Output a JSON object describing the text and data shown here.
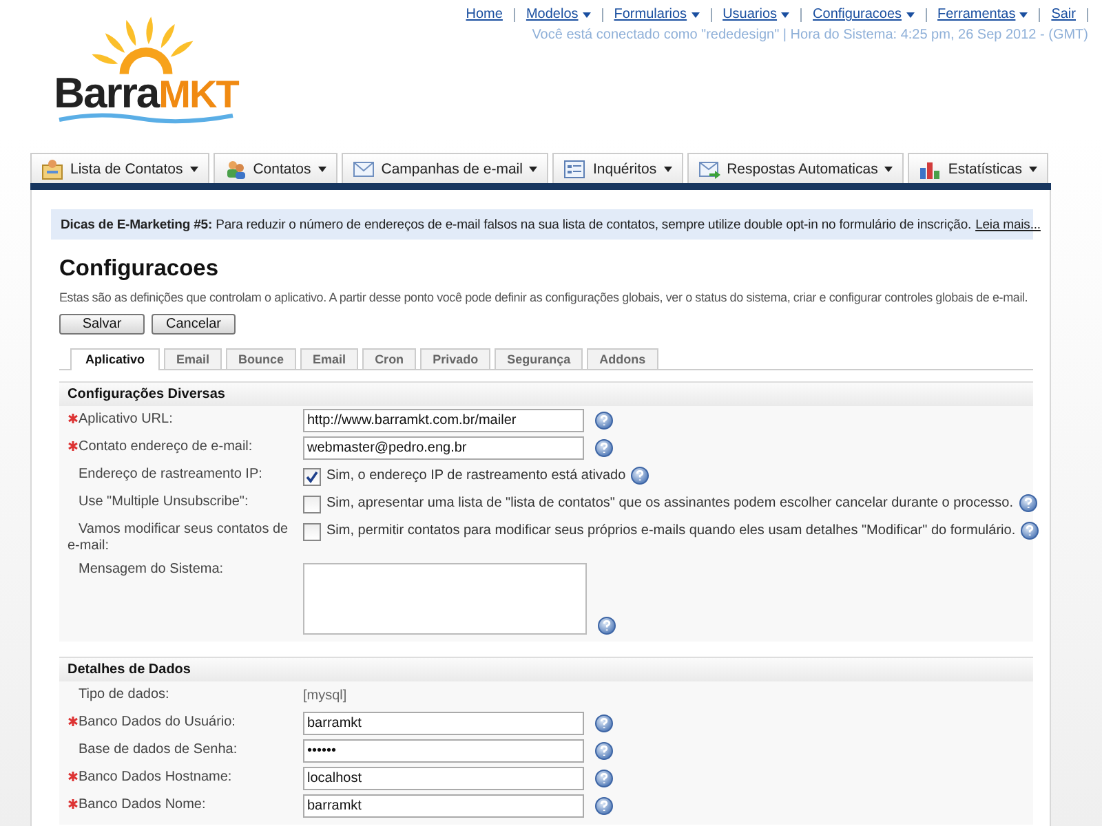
{
  "logo": {
    "part1": "Barra",
    "part2": "MKT"
  },
  "top_links": [
    {
      "label": "Home",
      "dropdown": false
    },
    {
      "label": "Modelos",
      "dropdown": true
    },
    {
      "label": "Formularios",
      "dropdown": true
    },
    {
      "label": "Usuarios",
      "dropdown": true
    },
    {
      "label": "Configuracoes",
      "dropdown": true
    },
    {
      "label": "Ferramentas",
      "dropdown": true
    },
    {
      "label": "Sair",
      "dropdown": false
    }
  ],
  "session_info": "Você está conectado como \"rededesign\" | Hora do Sistema: 4:25 pm, 26 Sep 2012 - (GMT)",
  "nav_tabs": [
    {
      "label": "Lista de Contatos"
    },
    {
      "label": "Contatos"
    },
    {
      "label": "Campanhas de e-mail"
    },
    {
      "label": "Inquéritos"
    },
    {
      "label": "Respostas Automaticas"
    },
    {
      "label": "Estatísticas"
    }
  ],
  "tip": "**Dicas de E-Marketing #5:** Para reduzir o número de endereços de e-mail falsos na sua lista de contatos, sempre utilize double opt-in no formulário de inscrição.",
  "tip_link": "Leia mais...",
  "title": "Configuracoes",
  "description": "Estas são as definições que controlam o aplicativo. A partir desse ponto você pode definir as configurações globais, ver o status do sistema, criar e configurar controles globais de e-mail.",
  "buttons": [
    "Salvar",
    "Cancelar"
  ],
  "tabs": [
    {
      "label": "Aplicativo",
      "selected": true
    },
    {
      "label": "Email",
      "selected": false
    },
    {
      "label": "Bounce",
      "selected": false
    },
    {
      "label": "Email",
      "selected": false
    },
    {
      "label": "Cron",
      "selected": false
    },
    {
      "label": "Privado",
      "selected": false
    },
    {
      "label": "Segurança",
      "selected": false
    },
    {
      "label": "Addons",
      "selected": false
    }
  ],
  "sections": [
    {
      "title": "Configurações Diversas",
      "rows": [
        {
          "kind": "input",
          "label": "Aplicativo URL:",
          "required": true,
          "value": "http://www.barramkt.com.br/mailer"
        },
        {
          "kind": "input",
          "label": "Contato endereço de e-mail:",
          "required": true,
          "value": "webmaster@pedro.eng.br"
        },
        {
          "kind": "check",
          "label": "Endereço de rastreamento IP:",
          "required": false,
          "checked": true,
          "text": "Sim, o endereço IP de rastreamento está ativado"
        },
        {
          "kind": "check",
          "label": "Use \"Multiple Unsubscribe\":",
          "required": false,
          "checked": false,
          "text": "Sim, apresentar uma lista de \"lista de contatos\" que os assinantes podem escolher cancelar durante o processo."
        },
        {
          "kind": "check",
          "label": "Vamos modificar seus contatos de e-mail:",
          "required": false,
          "checked": false,
          "text": "Sim, permitir contatos para modificar seus próprios e-mails quando eles usam detalhes \"Modificar\" do formulário."
        },
        {
          "kind": "textarea",
          "label": "Mensagem do Sistema:",
          "required": false
        }
      ]
    },
    {
      "title": "Detalhes de Dados",
      "rows": [
        {
          "kind": "static",
          "label": "Tipo de dados:",
          "required": false,
          "value": "[mysql]"
        },
        {
          "kind": "input",
          "label": "Banco Dados do Usuário:",
          "required": true,
          "value": "barramkt"
        },
        {
          "kind": "password",
          "label": "Base de dados de Senha:",
          "required": false,
          "value": "••••••"
        },
        {
          "kind": "input",
          "label": "Banco Dados Hostname:",
          "required": true,
          "value": "localhost"
        },
        {
          "kind": "input",
          "label": "Banco Dados Nome:",
          "required": true,
          "value": "barramkt"
        }
      ]
    }
  ]
}
